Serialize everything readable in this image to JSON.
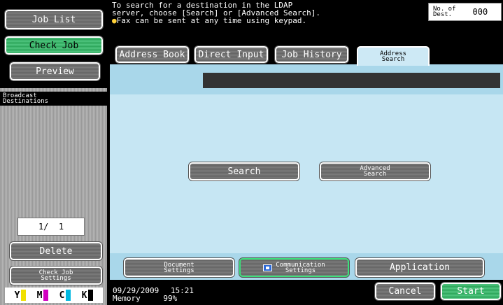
{
  "left": {
    "job_list_label": "Job List",
    "check_job_label": "Check Job",
    "preview_label": "Preview",
    "broadcast_label_line1": "Broadcast",
    "broadcast_label_line2": "Destinations",
    "pager_text": "1/  1",
    "delete_label": "Delete",
    "check_job_settings_line1": "Check Job",
    "check_job_settings_line2": "Settings",
    "toner": [
      {
        "letter": "Y",
        "color": "#f0e000"
      },
      {
        "letter": "M",
        "color": "#d100c0"
      },
      {
        "letter": "C",
        "color": "#00b8e0"
      },
      {
        "letter": "K",
        "color": "#000000"
      }
    ]
  },
  "header": {
    "message_line1": "To search for a destination in the LDAP",
    "message_line2": "server, choose [Search] or [Advanced Search].",
    "message_line3": "Fax can be sent at any time using keypad.",
    "dest_label_line1": "No. of",
    "dest_label_line2": "Dest.",
    "dest_count": "000"
  },
  "tabs": {
    "address_book": "Address Book",
    "direct_input": "Direct Input",
    "job_history": "Job History",
    "address_search_line1": "Address",
    "address_search_line2": "Search"
  },
  "main": {
    "search_label": "Search",
    "advanced_line1": "Advanced",
    "advanced_line2": "Search"
  },
  "bottom": {
    "document_settings_line1": "Document",
    "document_settings_line2": "Settings",
    "communication_settings_line1": "Communication",
    "communication_settings_line2": "Settings",
    "application_label": "Application",
    "cancel_label": "Cancel",
    "start_label": "Start",
    "date": "09/29/2009",
    "time": "15:21",
    "memory_label": "Memory",
    "memory_value": "99%"
  },
  "colors": {
    "content_bg": "#c6e6f3",
    "band": "#a9d7ea",
    "active_green": "#2fa85d"
  }
}
